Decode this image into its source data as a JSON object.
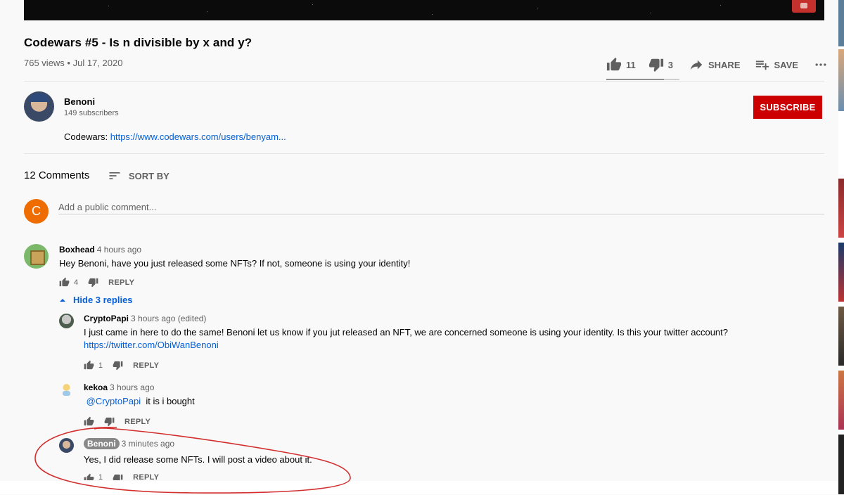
{
  "video": {
    "title": "Codewars #5 - Is n divisible by x and y?",
    "views": "765 views",
    "date": "Jul 17, 2020",
    "likes": "11",
    "dislikes": "3",
    "share_label": "SHARE",
    "save_label": "SAVE",
    "like_fraction": 0.785
  },
  "channel": {
    "name": "Benoni",
    "subscribers": "149 subscribers",
    "subscribe_label": "SUBSCRIBE",
    "description_prefix": "Codewars: ",
    "description_link": "https://www.codewars.com/users/benyam..."
  },
  "comments_header": {
    "count": "12 Comments",
    "sort_label": "SORT BY",
    "avatar_letter": "C",
    "placeholder": "Add a public comment..."
  },
  "comments": [
    {
      "author": "Boxhead",
      "time": "4 hours ago",
      "text": "Hey Benoni, have you just released some NFTs? If not, someone is using your identity!",
      "likes": "4",
      "reply_label": "REPLY",
      "hide_replies_label": "Hide 3 replies"
    }
  ],
  "replies": [
    {
      "author": "CryptoPapi",
      "time": "3 hours ago (edited)",
      "text": "I just came in here to do the same! Benoni let us know if you jut released an NFT, we are concerned someone is using your identity. Is this your twitter account?",
      "link": "https://twitter.com/ObiWanBenoni",
      "likes": "1",
      "reply_label": "REPLY"
    },
    {
      "author": "kekoa",
      "time": "3 hours ago",
      "mention": "@CryptoPapi",
      "text": "it is i bought",
      "reply_label": "REPLY"
    },
    {
      "author": "Benoni",
      "time": "3 minutes ago",
      "text": "Yes, I did release some NFTs. I will post a video about it.",
      "likes": "1",
      "reply_label": "REPLY"
    }
  ],
  "colors": {
    "subscribe": "#cc0000",
    "link": "#065fd4",
    "annotation": "#d32f2f",
    "me_avatar": "#ef6c00"
  }
}
